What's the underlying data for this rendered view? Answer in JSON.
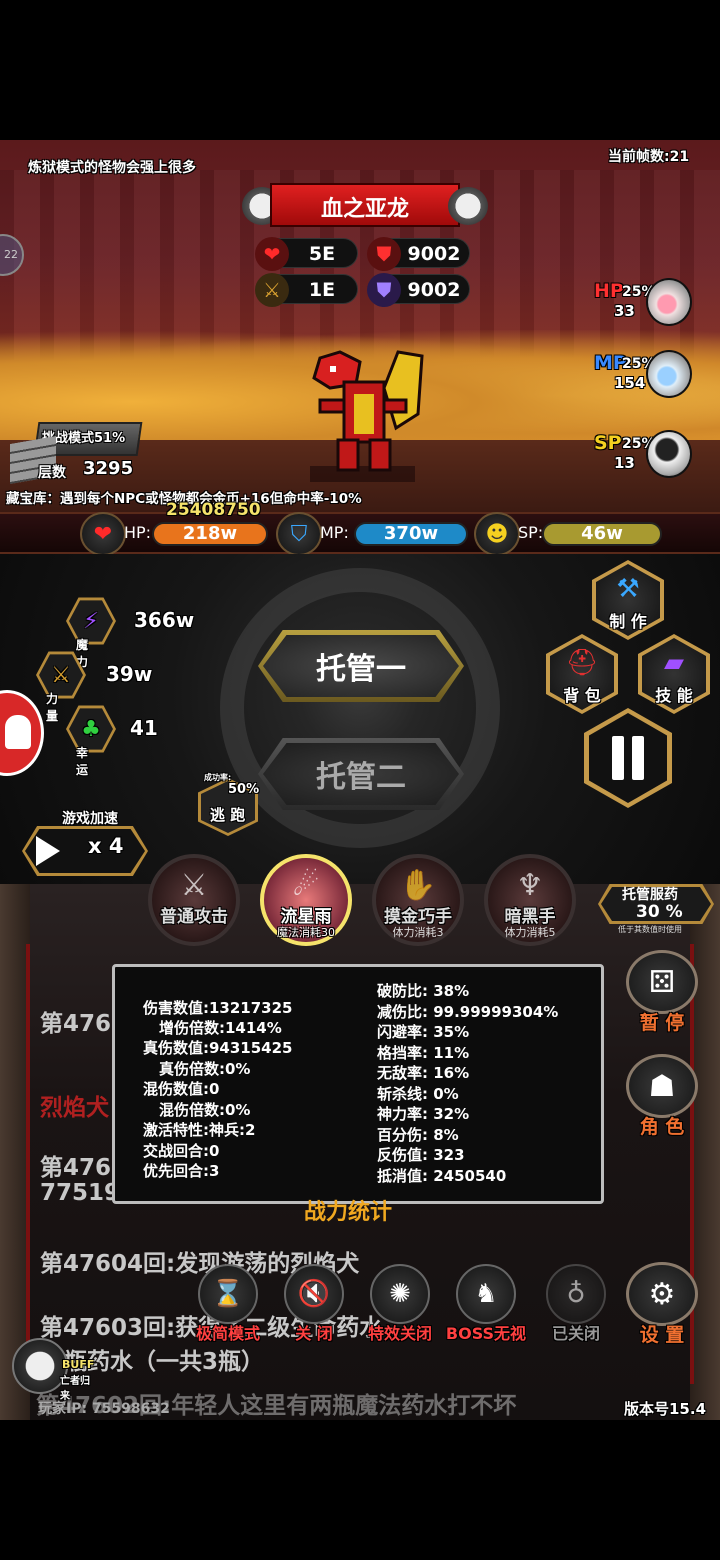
{
  "hud": {
    "notice": "炼狱模式的怪物会强上很多",
    "fps": "当前帧数:21",
    "level_badge": "22"
  },
  "boss": {
    "name": "血之亚龙",
    "hp": "5E",
    "atk": "1E",
    "phys_def": "9002",
    "magic_def": "9002"
  },
  "potions": [
    {
      "label": "HP",
      "pct": "25%",
      "count": "33",
      "color": "#ff3030"
    },
    {
      "label": "MP",
      "pct": "25%",
      "count": "154",
      "color": "#3a8aff"
    },
    {
      "label": "SP",
      "pct": "25%",
      "count": "13",
      "color": "#f5d020"
    }
  ],
  "challenge": {
    "label": "挑战模式51%",
    "floor_label": "层数",
    "floor_value": "3295"
  },
  "treasure": "藏宝库：遇到每个NPC或怪物都会金币+16但命中率-10%",
  "gold": "25408750",
  "resources": {
    "hp": {
      "key": "HP:",
      "value": "218w",
      "color": "#e8741c"
    },
    "mp": {
      "key": "MP:",
      "value": "370w",
      "color": "#1e8ac8"
    },
    "sp": {
      "key": "SP:",
      "value": "46w",
      "color": "#a89a30"
    }
  },
  "attributes": [
    {
      "name": "魔 力",
      "value": "366w",
      "icon": "lightning-icon"
    },
    {
      "name": "力 量",
      "value": "39w",
      "icon": "sword-icon"
    },
    {
      "name": "幸 运",
      "value": "41",
      "icon": "clover-icon"
    }
  ],
  "auto": {
    "one": "托管一",
    "two": "托管二"
  },
  "escape": {
    "rate_label": "成功率:",
    "rate": "50%",
    "label": "逃 跑"
  },
  "menu": {
    "craft": "制 作",
    "bag": "背 包",
    "skill": "技 能"
  },
  "speed": {
    "label": "游戏加速",
    "mult": "x 4"
  },
  "skills": [
    {
      "name": "普通攻击",
      "cost": "",
      "active": false
    },
    {
      "name": "流星雨",
      "cost": "魔法消耗30",
      "active": true
    },
    {
      "name": "摸金巧手",
      "cost": "体力消耗3",
      "active": false
    },
    {
      "name": "暗黑手",
      "cost": "体力消耗5",
      "active": false
    }
  ],
  "auto_potion": {
    "title": "托管服药",
    "value": "30 %",
    "note": "低于其数值时使用"
  },
  "logs": [
    {
      "text": "第476",
      "red": false
    },
    {
      "text": "烈焰犬",
      "red": true
    },
    {
      "text": "第476",
      "red": false
    },
    {
      "text": "77519",
      "red": false
    },
    {
      "text": "第47604回:发现游荡的烈焰犬",
      "red": false
    },
    {
      "text": "第47603回:获得了二级生命药水",
      "red": false
    },
    {
      "text": "瓶药水（一共3瓶）",
      "red": false
    },
    {
      "text": "第47602回:年轻人这里有两瓶魔法药水打不坏",
      "red": false
    }
  ],
  "combat": {
    "title": "战力统计",
    "left": [
      "伤害数值:13217325",
      "增伤倍数:1414%",
      "真伤数值:94315425",
      "真伤倍数:0%",
      "混伤数值:0",
      "混伤倍数:0%",
      "激活特性:神兵:2",
      "交战回合:0",
      "优先回合:3"
    ],
    "right": [
      "破防比:  38%",
      "减伤比:  99.99999304%",
      "闪避率:  35%",
      "格挡率:  11%",
      "无敌率:  16%",
      "斩杀线:  0%",
      "神力率:  32%",
      "百分伤:  8%",
      "反伤值:  323",
      "抵消值:  2450540"
    ]
  },
  "right_buttons": {
    "pause": "暂 停",
    "role": "角 色",
    "settings": "设 置"
  },
  "tools": [
    {
      "label": "极简模式",
      "icon": "hourglass-icon",
      "off": false
    },
    {
      "label": "关 闭",
      "icon": "mute-icon",
      "off": false
    },
    {
      "label": "特效关闭",
      "icon": "effect-icon",
      "off": false
    },
    {
      "label": "BOSS无视",
      "icon": "dragon-icon",
      "off": false
    },
    {
      "label": "已关闭",
      "icon": "bag-icon",
      "off": true
    }
  ],
  "buff": {
    "title": "BUFF",
    "sub": "亡者归来"
  },
  "footer": {
    "ip": "玩家IP:   75598632",
    "version": "版本号15.4"
  }
}
